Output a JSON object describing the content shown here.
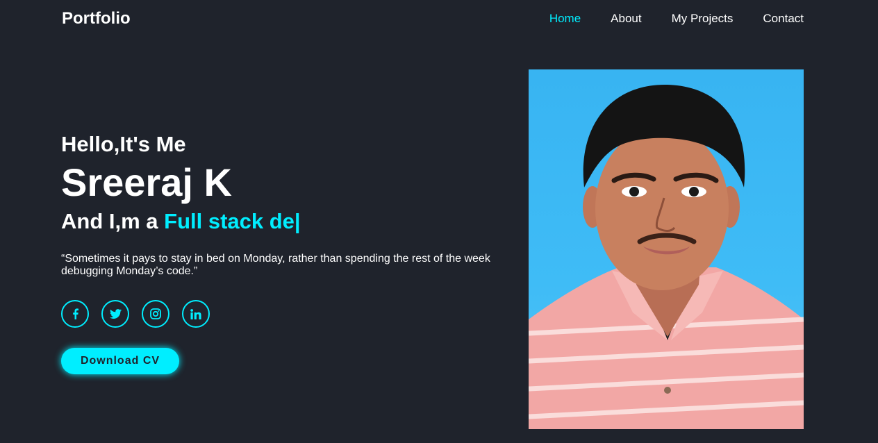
{
  "header": {
    "logo": "Portfolio",
    "nav": [
      "Home",
      "About",
      "My Projects",
      "Contact"
    ],
    "active_nav": "Home"
  },
  "hero": {
    "greeting": "Hello,It's Me",
    "name": "Sreeraj K",
    "role_prefix": "And I,m a ",
    "role_typed": "Full stack de|",
    "quote": "“Sometimes it pays to stay in bed on Monday, rather than spending the rest of the week debugging Monday’s code.”",
    "socials": [
      "facebook-icon",
      "twitter-icon",
      "instagram-icon",
      "linkedin-icon"
    ],
    "cta": "Download CV"
  },
  "colors": {
    "background": "#1f232c",
    "accent": "#00eeff",
    "text": "#ffffff",
    "photo_background": "#3fbcf6",
    "shirt": "#f0a4a4"
  }
}
